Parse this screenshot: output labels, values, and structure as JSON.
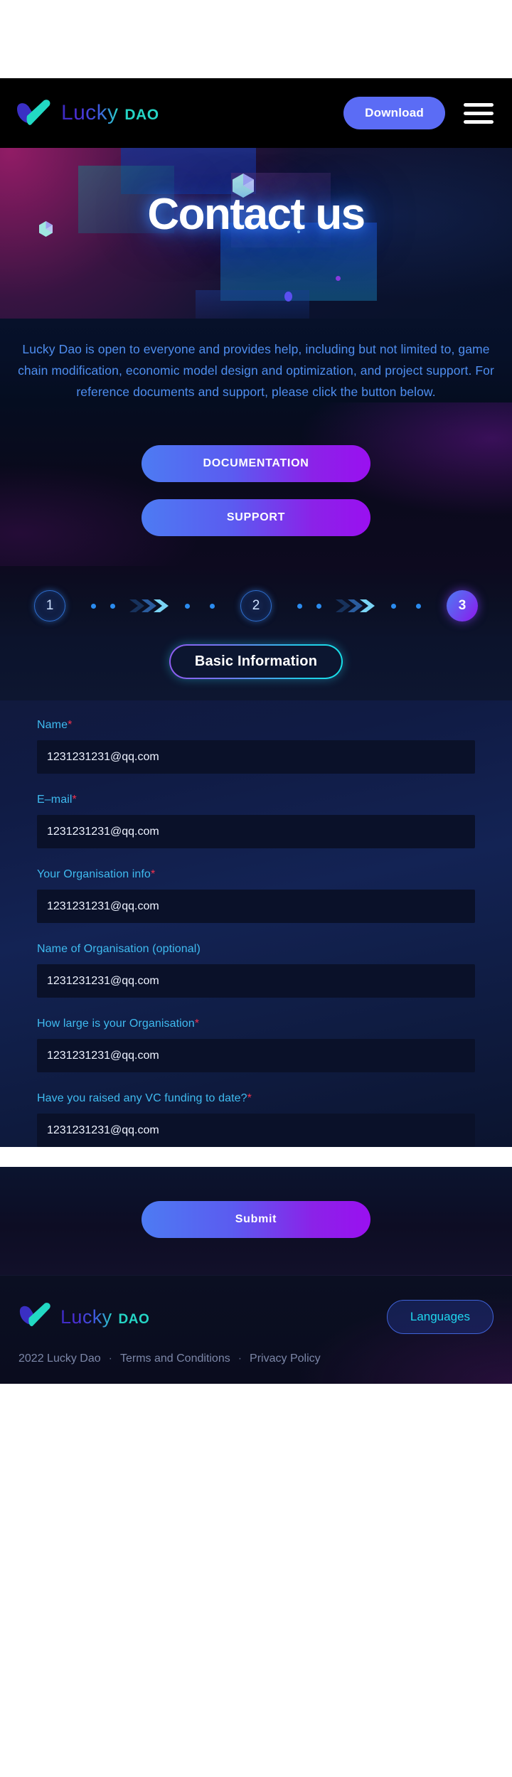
{
  "brand": {
    "name_primary": "Lucky",
    "name_secondary": "DAO"
  },
  "header": {
    "download_label": "Download",
    "menu_icon": "hamburger-menu-icon",
    "logo_icon": "lucky-dao-checkmark-logo"
  },
  "hero": {
    "title": "Contact us",
    "decor_cube_icon": "hexagon-cube-icon"
  },
  "intro": {
    "text": "Lucky Dao is open to everyone and provides help, including but not limited to, game chain modification, economic model design and optimization, and project support. For reference documents and support, please click the button below."
  },
  "cta": {
    "documentation_label": "DOCUMENTATION",
    "support_label": "SUPPORT"
  },
  "steps": {
    "items": [
      {
        "label": "1",
        "state": "inactive"
      },
      {
        "label": "2",
        "state": "inactive"
      },
      {
        "label": "3",
        "state": "active"
      }
    ]
  },
  "tab": {
    "label": "Basic Information"
  },
  "form": {
    "fields": [
      {
        "label": "Name",
        "required": true,
        "value": "1231231231@qq.com",
        "placeholder": "1231231231@qq.com"
      },
      {
        "label": "E–mail",
        "required": true,
        "value": "1231231231@qq.com",
        "placeholder": "1231231231@qq.com"
      },
      {
        "label": "Your Organisation info",
        "required": true,
        "value": "1231231231@qq.com",
        "placeholder": "1231231231@qq.com"
      },
      {
        "label": "Name of Organisation (optional)",
        "required": false,
        "value": "1231231231@qq.com",
        "placeholder": "1231231231@qq.com"
      },
      {
        "label": "How large is your Organisation",
        "required": true,
        "value": "1231231231@qq.com",
        "placeholder": "1231231231@qq.com"
      },
      {
        "label": "Have you raised any VC funding to date?",
        "required": true,
        "value": "1231231231@qq.com",
        "placeholder": "1231231231@qq.com"
      }
    ],
    "required_marker": "*",
    "submit_label": "Submit"
  },
  "footer": {
    "languages_label": "Languages",
    "copyright": "2022 Lucky Dao",
    "terms_label": "Terms and Conditions",
    "privacy_label": "Privacy Policy",
    "separator": "·"
  },
  "colors": {
    "accent_blue": "#5b6cf5",
    "accent_cyan": "#25d5c5",
    "label_cyan": "#3fbbf0",
    "required_red": "#f5334d",
    "gradient_start": "#4d7bf3",
    "gradient_end": "#9a10f0",
    "header_bg": "#000000",
    "input_bg": "#0a1129"
  }
}
